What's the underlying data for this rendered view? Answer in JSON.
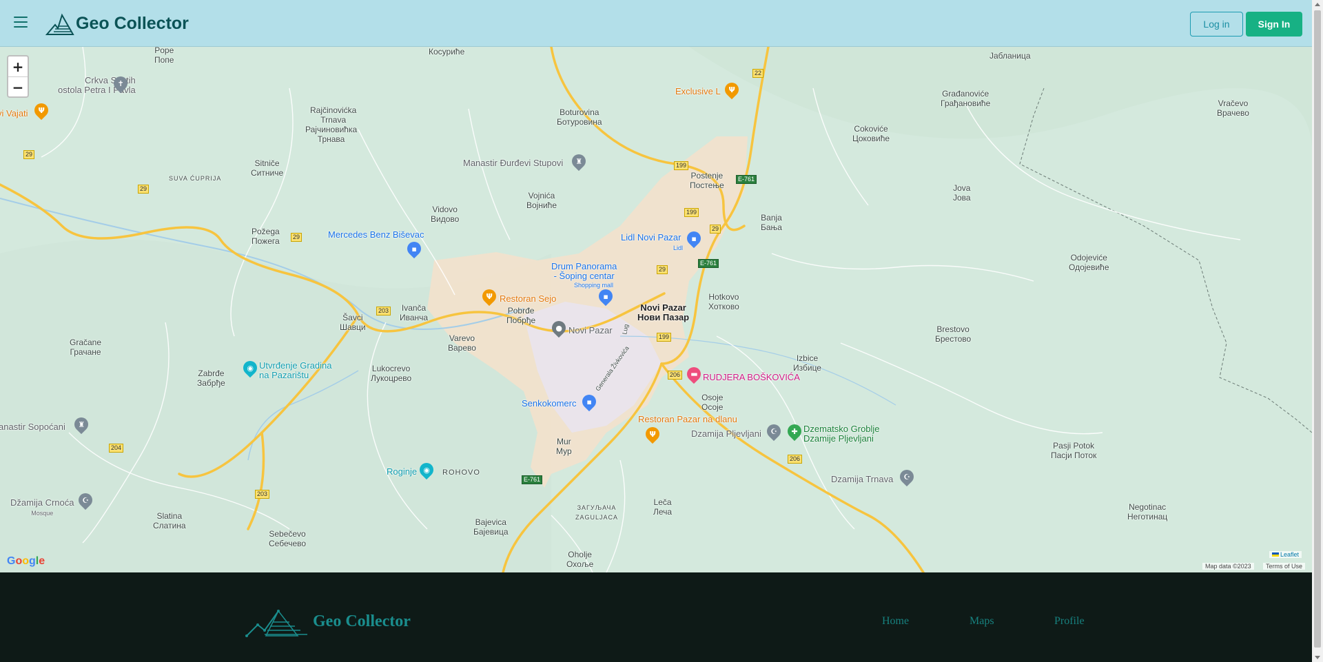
{
  "header": {
    "app_title": "Geo Collector",
    "login_label": "Log in",
    "signin_label": "Sign In"
  },
  "map": {
    "zoom_in": "+",
    "zoom_out": "−",
    "attribution_leaflet": "Leaflet",
    "attribution_data": "Map data ©2023",
    "attribution_terms": "Terms of Use",
    "google": "Google",
    "places": [
      {
        "l1": "Pope",
        "l2": "Попе"
      },
      {
        "l1": "Косуриће",
        "l2": ""
      },
      {
        "l1": "Rajčinovićka",
        "l2": "Trnava"
      },
      {
        "l1": "Рајчиновићка",
        "l2": "Трнава"
      },
      {
        "l1": "Boturovina",
        "l2": "Ботуровина"
      },
      {
        "l1": "Sitniče",
        "l2": "Ситниче"
      },
      {
        "l1": "Vidovo",
        "l2": "Видово"
      },
      {
        "l1": "Vojnića",
        "l2": "Војниће"
      },
      {
        "l1": "Postenje",
        "l2": "Постење"
      },
      {
        "l1": "Banja",
        "l2": "Бања"
      },
      {
        "l1": "Požega",
        "l2": "Пожега"
      },
      {
        "l1": "Ivanča",
        "l2": "Иванча"
      },
      {
        "l1": "Šavci",
        "l2": "Шавци"
      },
      {
        "l1": "Pobrđe",
        "l2": "Побрђе"
      },
      {
        "l1": "Novi Pazar",
        "l2": "Нови Пазар"
      },
      {
        "l1": "Hotkovo",
        "l2": "Хотково"
      },
      {
        "l1": "Gračane",
        "l2": "Грачане"
      },
      {
        "l1": "Varevo",
        "l2": "Варево"
      },
      {
        "l1": "Lukocrevo",
        "l2": "Лукоцрево"
      },
      {
        "l1": "Zabrđe",
        "l2": "Забрђе"
      },
      {
        "l1": "Izbice",
        "l2": "Избице"
      },
      {
        "l1": "Osoje",
        "l2": "Осоје"
      },
      {
        "l1": "Mur",
        "l2": "Мур"
      },
      {
        "l1": "Slatina",
        "l2": "Слатина"
      },
      {
        "l1": "Sebečevo",
        "l2": "Себечево"
      },
      {
        "l1": "Bajevica",
        "l2": "Бајевица"
      },
      {
        "l1": "Leča",
        "l2": "Леча"
      },
      {
        "l1": "Oholje",
        "l2": "Охоље"
      },
      {
        "l1": "Građanoviće",
        "l2": "Грађановиће"
      },
      {
        "l1": "Jablanica",
        "l2": "Јабланица"
      },
      {
        "l1": "Cokoviće",
        "l2": "Цоковиће"
      },
      {
        "l1": "Vračevo",
        "l2": "Врачево"
      },
      {
        "l1": "Jova",
        "l2": "Јова"
      },
      {
        "l1": "Odojeviće",
        "l2": "Одојевиће"
      },
      {
        "l1": "Brestovo",
        "l2": "Брестово"
      },
      {
        "l1": "Pasji Potok",
        "l2": "Пасји Поток"
      },
      {
        "l1": "Negotinac",
        "l2": "Неготинац"
      },
      {
        "l1": "ROHOVO",
        "l2": ""
      },
      {
        "l1": "ЗАГУЉАЧА",
        "l2": "ZAGULJACA"
      },
      {
        "l1": "SUVA ĆUPRIJA",
        "l2": ""
      }
    ],
    "pois": [
      {
        "name": "Crkva Svetih",
        "sub": "ostola Petra I Pavla"
      },
      {
        "name": "vi Vajati",
        "sub": ""
      },
      {
        "name": "Exclusive L",
        "sub": ""
      },
      {
        "name": "Manastir Đurđevi Stupovi",
        "sub": ""
      },
      {
        "name": "Mercedes Benz Biševac",
        "sub": ""
      },
      {
        "name": "Lidl Novi Pazar",
        "sub": "Lidl"
      },
      {
        "name": "Drum Panorama",
        "sub": "- Šoping centar"
      },
      {
        "name": "Shopping mall",
        "sub": ""
      },
      {
        "name": "Restoran Sejo",
        "sub": ""
      },
      {
        "name": "Novi Pazar",
        "sub": ""
      },
      {
        "name": "Utvrđenje Gradina",
        "sub": "na Pazarištu"
      },
      {
        "name": "RUDJERA BOŠKOVIĆA",
        "sub": ""
      },
      {
        "name": "Senkokomerc",
        "sub": ""
      },
      {
        "name": "Restoran Pazar na dlanu",
        "sub": ""
      },
      {
        "name": "Dzamija Pljevljani",
        "sub": ""
      },
      {
        "name": "Dzematsko Groblje",
        "sub": "Dzamije Pljevljani"
      },
      {
        "name": "anastir Sopoćani",
        "sub": ""
      },
      {
        "name": "Roginje",
        "sub": ""
      },
      {
        "name": "Džamija Crnoća",
        "sub": "Mosque"
      },
      {
        "name": "Dzamija Trnava",
        "sub": ""
      }
    ],
    "streets": [
      "Generala Živkovića",
      "Lug"
    ],
    "roads": [
      "29",
      "29",
      "29",
      "29",
      "22",
      "199",
      "199",
      "199",
      "E-761",
      "E-761",
      "E-761",
      "203",
      "203",
      "204",
      "206",
      "206",
      "29"
    ]
  },
  "footer": {
    "app_title": "Geo Collector",
    "links": [
      "Home",
      "Maps",
      "Profile"
    ]
  }
}
